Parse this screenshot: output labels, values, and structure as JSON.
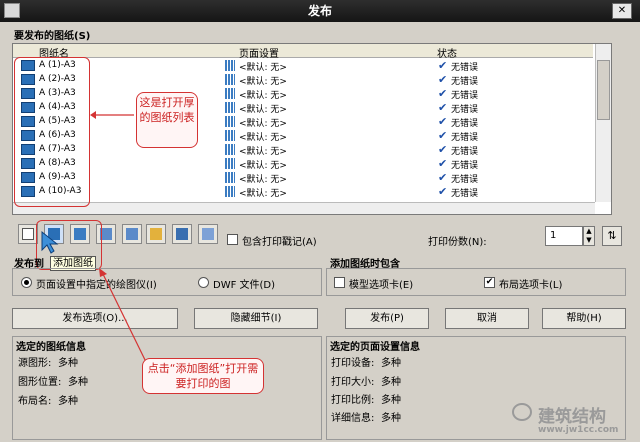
{
  "window": {
    "title": "发布",
    "close_label": "✕"
  },
  "sheets_section": {
    "label": "要发布的图纸(S)"
  },
  "columns": {
    "name": "图纸名",
    "setup": "页面设置",
    "status": "状态"
  },
  "rows": [
    {
      "name": "A (1)-A3",
      "setup": "<默认: 无>",
      "status": "无错误"
    },
    {
      "name": "A (2)-A3",
      "setup": "<默认: 无>",
      "status": "无错误"
    },
    {
      "name": "A (3)-A3",
      "setup": "<默认: 无>",
      "status": "无错误"
    },
    {
      "name": "A (4)-A3",
      "setup": "<默认: 无>",
      "status": "无错误"
    },
    {
      "name": "A (5)-A3",
      "setup": "<默认: 无>",
      "status": "无错误"
    },
    {
      "name": "A (6)-A3",
      "setup": "<默认: 无>",
      "status": "无错误"
    },
    {
      "name": "A (7)-A3",
      "setup": "<默认: 无>",
      "status": "无错误"
    },
    {
      "name": "A (8)-A3",
      "setup": "<默认: 无>",
      "status": "无错误"
    },
    {
      "name": "A (9)-A3",
      "setup": "<默认: 无>",
      "status": "无错误"
    },
    {
      "name": "A (10)-A3",
      "setup": "<默认: 无>",
      "status": "无错误"
    }
  ],
  "callout_list": "这是打开厚的图纸列表",
  "toolbar": {
    "include_stamp_label": "包含打印戳记(A)",
    "copies_label": "打印份数(N):",
    "copies_value": "1",
    "tooltip": "添加图纸"
  },
  "publish_to": {
    "label": "发布到",
    "option_plotter": "页面设置中指定的绘图仪(I)",
    "option_dwf": "DWF 文件(D)"
  },
  "include_when_adding": {
    "label": "添加图纸时包含",
    "model_tab": "模型选项卡(E)",
    "layout_tab": "布局选项卡(L)"
  },
  "buttons": {
    "publish_options": "发布选项(O)...",
    "hide_details": "隐藏细节(I)",
    "publish": "发布(P)",
    "cancel": "取消",
    "help": "帮助(H)"
  },
  "selected_sheet_info": {
    "label": "选定的图纸信息",
    "source_drawing_label": "源图形:",
    "source_drawing_value": "多种",
    "drawing_location_label": "图形位置:",
    "drawing_location_value": "多种",
    "layout_name_label": "布局名:",
    "layout_name_value": "多种"
  },
  "callout_add": "点击“添加图纸”打开需要打印的图",
  "page_setup_info": {
    "label": "选定的页面设置信息",
    "plot_device_label": "打印设备:",
    "plot_device_value": "多种",
    "plot_size_label": "打印大小:",
    "plot_size_value": "多种",
    "plot_scale_label": "打印比例:",
    "plot_scale_value": "多种",
    "details_label": "详细信息:",
    "details_value": "多种"
  },
  "watermark": {
    "brand": "建筑结构",
    "url": "www.jw1cc.com"
  }
}
